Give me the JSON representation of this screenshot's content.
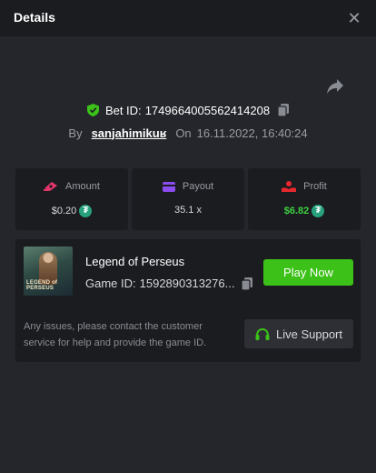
{
  "header": {
    "title": "Details"
  },
  "bet": {
    "bet_id_label": "Bet ID:",
    "bet_id": "1749664005562414208",
    "by_label": "By",
    "username": "sanjahimikuʁ",
    "on_label": "On",
    "datetime": "16.11.2022, 16:40:24"
  },
  "stats": {
    "amount_label": "Amount",
    "amount_value": "$0.20",
    "payout_label": "Payout",
    "payout_value": "35.1 x",
    "profit_label": "Profit",
    "profit_value": "$6.82",
    "currency_glyph": "₮"
  },
  "game": {
    "thumb_logo": "LEGEND of PERSEUS",
    "name": "Legend of Perseus",
    "id_label": "Game ID:",
    "id_value": "1592890313276...",
    "play_label": "Play Now",
    "support_text": "Any issues, please contact the customer service for help and provide the game ID.",
    "support_label": "Live Support"
  },
  "colors": {
    "background": "#24262b",
    "card": "#1b1c20",
    "accent_green": "#3bc117",
    "profit_green": "#3dd13f",
    "amount_icon": "#e3366b",
    "payout_icon": "#8b4cf0",
    "profit_icon": "#e5282f",
    "tether": "#26a17b"
  },
  "icons": [
    "close-icon",
    "share-icon",
    "shield-check-icon",
    "copy-icon",
    "money-icon",
    "wallet-icon",
    "hand-coin-icon",
    "tether-icon",
    "headset-icon"
  ]
}
